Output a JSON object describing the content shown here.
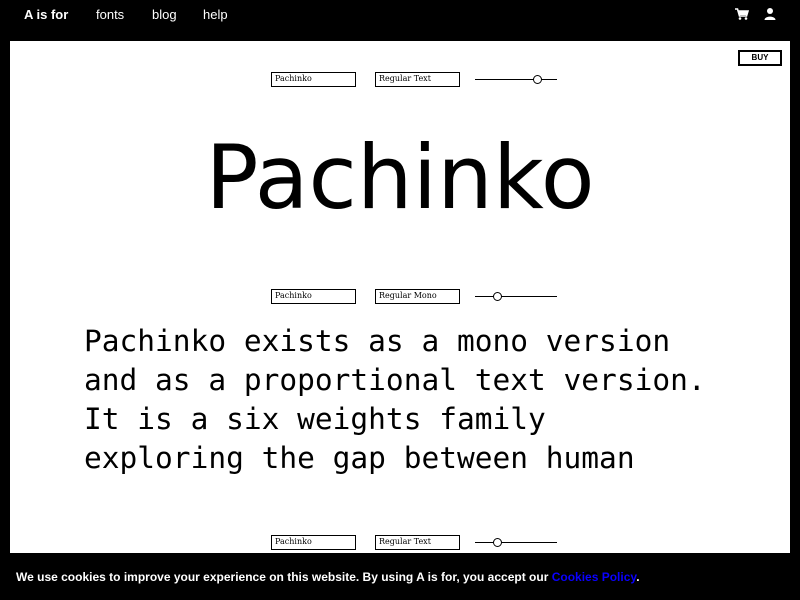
{
  "nav": {
    "brand": "A is for",
    "links": [
      "fonts",
      "blog",
      "help"
    ],
    "icons": [
      "cart-icon",
      "user-icon"
    ]
  },
  "panel": {
    "buy_label": "BUY",
    "display_controls": {
      "font": "Pachinko",
      "style": "Regular Text",
      "slider_level": 0.8
    },
    "display_text": "Pachinko",
    "paragraph_controls": {
      "font": "Pachinko",
      "style": "Regular Mono",
      "slider_level": 0.25
    },
    "paragraph_text": "Pachinko exists as a mono version\nand as a proportional text version.\nIt is a six weights family\nexploring the gap between human",
    "bottom_controls": {
      "font": "Pachinko",
      "style": "Regular Text",
      "slider_level": 0.25
    }
  },
  "cookie": {
    "text": "We use cookies to improve your experience on this website. By using A is for, you accept our ",
    "link": "Cookies Policy",
    "suffix": "."
  },
  "colors": {
    "background": "#000000",
    "panel": "#ffffff",
    "link": "#0a00ff"
  }
}
